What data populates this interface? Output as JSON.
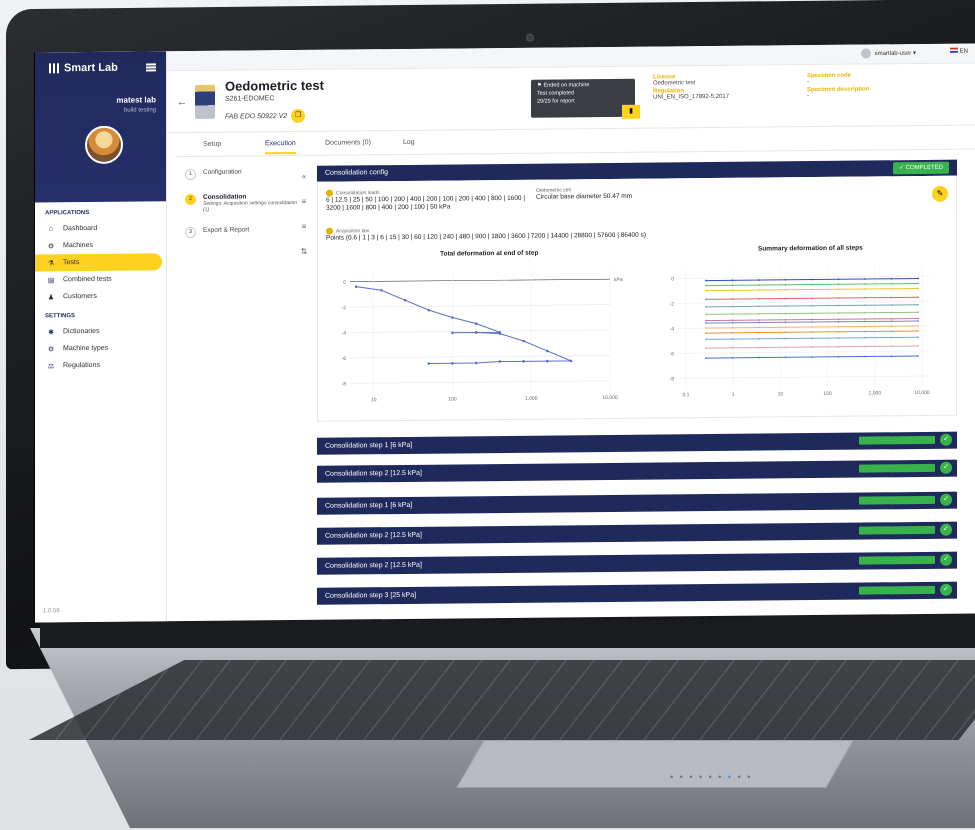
{
  "sidebar": {
    "logo": "Smart Lab",
    "user_name": "matest lab",
    "user_sub": "build testing",
    "section_apps": "APPLICATIONS",
    "apps": [
      {
        "label": "Dashboard",
        "icon": "home-icon"
      },
      {
        "label": "Machines",
        "icon": "machine-icon"
      },
      {
        "label": "Tests",
        "icon": "flask-icon"
      },
      {
        "label": "Combined tests",
        "icon": "combined-icon"
      },
      {
        "label": "Customers",
        "icon": "users-icon"
      }
    ],
    "section_settings": "SETTINGS",
    "settings": [
      {
        "label": "Dictionaries",
        "icon": "gear-icon"
      },
      {
        "label": "Machine types",
        "icon": "machine-icon"
      },
      {
        "label": "Regulations",
        "icon": "regulation-icon"
      }
    ],
    "version": "1.0.56"
  },
  "topbar": {
    "user": "smartlab-user",
    "lang": "EN"
  },
  "header": {
    "title": "Oedometric test",
    "code": "S261-EDOMEC",
    "fab": "FAB EDO 50922 V2",
    "status_title": "Ended on machine",
    "status_line1": "Test completed",
    "status_line2": "29/29 for report",
    "license_label": "License",
    "license_value": "Oedometric test",
    "regulation_label": "Regulation",
    "regulation_value": "UNI_EN_ISO_17892-5:2017",
    "specimen_code_label": "Specimen code",
    "specimen_code_value": "-",
    "specimen_desc_label": "Specimen description",
    "specimen_desc_value": "-"
  },
  "tabs": [
    "Setup",
    "Execution",
    "Documents (0)",
    "Log"
  ],
  "steps": {
    "s1": {
      "num": "1",
      "title": "Configuration"
    },
    "s2": {
      "num": "2",
      "title": "Consolidation",
      "sub": "Settings: Acquisition settings consolidation (1)"
    },
    "s3": {
      "num": "3",
      "title": "Export & Report"
    }
  },
  "panel": {
    "title": "Consolidation config",
    "status": "COMPLETED",
    "loads_label": "Consolidation loads",
    "loads_value": "6 | 12.5 | 25 | 50 | 100 | 200 | 400 | 200 | 100 | 200 | 400 | 800 | 1600 | 3200 | 1600 | 800 | 400 | 200 | 100 | 50 kPa",
    "cell_label": "Oedometric cell",
    "cell_value": "Circular base diameter 50.47 mm",
    "acq_label": "Acquisition law",
    "acq_value": "Points (0.6 | 1 | 3 | 6 | 15 | 30 | 60 | 120 | 240 | 480 | 900 | 1800 | 3600 | 7200 | 14400 | 28800 | 57600 | 86400 s)"
  },
  "chart_data": [
    {
      "type": "line",
      "title": "Total deformation at end of step",
      "xlabel": "kPa",
      "x_scale": "log",
      "xticks": [
        "10",
        "100",
        "1,000",
        "10,000"
      ],
      "yticks": [
        "0",
        "-2",
        "-4",
        "-6",
        "-8"
      ],
      "xlim": [
        5,
        10000
      ],
      "ylim": [
        -8.8,
        0.8
      ],
      "series": [
        {
          "x": [
            6,
            12.5,
            25,
            50,
            100,
            200,
            400,
            200,
            100,
            200,
            400,
            800,
            1600,
            3200,
            1600,
            800,
            400,
            200,
            100,
            50
          ],
          "y": [
            -0.4,
            -0.7,
            -1.5,
            -2.3,
            -2.9,
            -3.4,
            -4.1,
            -4.1,
            -4.1,
            -4.1,
            -4.2,
            -4.8,
            -5.6,
            -6.4,
            -6.4,
            -6.4,
            -6.4,
            -6.5,
            -6.5,
            -6.5
          ]
        }
      ],
      "color": "#5b6fc7"
    },
    {
      "type": "line",
      "title": "Summary deformation of all steps",
      "x_scale": "log",
      "xticks": [
        "0.1",
        "1",
        "10",
        "100",
        "1,000",
        "10,000"
      ],
      "yticks": [
        "0",
        "-2",
        "-4",
        "-6",
        "-8"
      ],
      "series_levels": [
        -0.2,
        -0.6,
        -1.0,
        -1.7,
        -2.3,
        -2.9,
        -3.4,
        -3.6,
        -4.0,
        -4.4,
        -4.9,
        -5.6,
        -6.4
      ],
      "colors": [
        "#3a4bb5",
        "#5cbf6a",
        "#f1c232",
        "#e06666",
        "#76a5af",
        "#93c47d",
        "#c27ba0",
        "#8e7cc3",
        "#f6b26b",
        "#e69138",
        "#6fa8dc",
        "#d5a6bd",
        "#4a6fd1"
      ]
    }
  ],
  "step_bars": [
    "Consolidation step 1 [6 kPa]",
    "Consolidation step 2 [12.5 kPa]",
    "Consolidation step 1 [6 kPa]",
    "Consolidation step 2 [12.5 kPa]",
    "Consolidation step 2 [12.5 kPa]",
    "Consolidation step 3 [25 kPa]"
  ]
}
